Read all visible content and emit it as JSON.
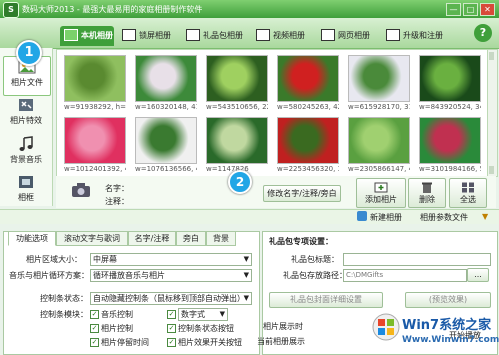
{
  "window": {
    "title": "数码大师2013 - 最强大最易用的家庭相册制作软件",
    "logo": "S",
    "btn_min": "—",
    "btn_max": "□",
    "btn_close": "✕"
  },
  "tabs": [
    {
      "label": "本机相册",
      "active": true
    },
    {
      "label": "锁屏相册"
    },
    {
      "label": "礼品包相册"
    },
    {
      "label": "视频相册"
    },
    {
      "label": "网页相册"
    },
    {
      "label": "升级和注册"
    }
  ],
  "sidebar": {
    "items": [
      {
        "label": "相片文件",
        "icon": "photo-file-icon"
      },
      {
        "label": "相片特效",
        "icon": "effects-icon"
      },
      {
        "label": "背景音乐",
        "icon": "music-note-icon"
      },
      {
        "label": "相框",
        "icon": "frame-icon"
      }
    ],
    "badge1": "1"
  },
  "photos": [
    {
      "caption": "w=91938292, h=2",
      "color1": "#8fbf5f",
      "color2": "#5a8a30"
    },
    {
      "caption": "w=160320148, 41",
      "color1": "#3d8a3a",
      "color2": "#e8e0e8"
    },
    {
      "caption": "w=543510656, 22",
      "color1": "#2d5f20",
      "color2": "#9fd060"
    },
    {
      "caption": "w=580245263, 42",
      "color1": "#3a7a2a",
      "color2": "#d02020"
    },
    {
      "caption": "w=615928170, 31",
      "color1": "#e8e8f0",
      "color2": "#4a8a3a"
    },
    {
      "caption": "w=843920524, 34",
      "color1": "#1a4a1a",
      "color2": "#6ab040"
    },
    {
      "caption": "w=1012401392, 4",
      "color1": "#e03060",
      "color2": "#f090b0"
    },
    {
      "caption": "w=1076136566, 4",
      "color1": "#f0f0f0",
      "color2": "#3a7a30"
    },
    {
      "caption": "w=1147826",
      "color1": "#2a6a2a",
      "color2": "#c0d8a0"
    },
    {
      "caption": "w=2253456320, 3",
      "color1": "#c02020",
      "color2": "#3a6a20"
    },
    {
      "caption": "w=2305866147, 4",
      "color1": "#5aa040",
      "color2": "#a0d070"
    },
    {
      "caption": "w=3101984166, 5",
      "color1": "#2a8a3a",
      "color2": "#c03050"
    }
  ],
  "info": {
    "name_label": "名字：",
    "note_label": "注释：",
    "badge2": "2",
    "edit_btn": "修改名字/注释/旁白",
    "add_photo": "添加相片",
    "delete": "删除",
    "select_all": "全选"
  },
  "albumbar": {
    "new_album": "新建相册",
    "album_params": "相册参数文件"
  },
  "settings": {
    "tabs": [
      "功能选项",
      "滚动文字与歌词",
      "名字/注释",
      "旁白",
      "背景"
    ],
    "size_label": "相片区域大小：",
    "size_value": "中屏幕",
    "loop_label": "音乐与相片循环方案：",
    "loop_value": "循环播放音乐与相片",
    "ctrl_label": "控制条状态：",
    "ctrl_value": "自动隐藏控制条（鼠标移到顶部自动弹出）",
    "module_label": "控制条模块：",
    "checks": [
      "音乐控制",
      "数字式",
      "相片控制",
      "控制条状态按钮",
      "相片停留时间",
      "相片效果开关按钮"
    ]
  },
  "gift": {
    "title": "礼品包专项设置：",
    "title_label": "礼品包标题：",
    "path_label": "礼品包存放路径：",
    "path_value": "C:\\DMGifts",
    "browse": "...",
    "detail_btn": "礼品包封面详细设置",
    "preview_btn": "(预览效果)",
    "display_label": "相片展示时",
    "current_label": "当前相册展示",
    "start_label": "开始播放"
  },
  "watermark": {
    "line1": "Win7系统之家",
    "line2": "Www.Winwin7.com"
  }
}
